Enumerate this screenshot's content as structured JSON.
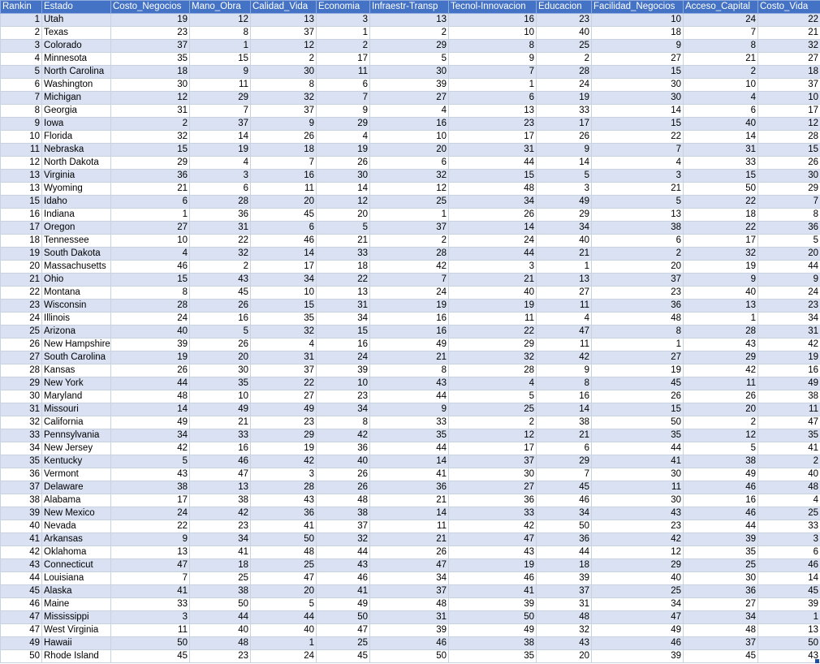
{
  "columns": [
    "Rankin",
    "Estado",
    "Costo_Negocios",
    "Mano_Obra",
    "Calidad_Vida",
    "Economia",
    "Infraestr-Transp",
    "Tecnol-Innovacion",
    "Educacion",
    "Facilidad_Negocios",
    "Acceso_Capital",
    "Costo_Vida"
  ],
  "rows": [
    [
      "1",
      "Utah",
      "19",
      "12",
      "13",
      "3",
      "13",
      "16",
      "23",
      "10",
      "24",
      "22"
    ],
    [
      "2",
      "Texas",
      "23",
      "8",
      "37",
      "1",
      "2",
      "10",
      "40",
      "18",
      "7",
      "21"
    ],
    [
      "3",
      "Colorado",
      "37",
      "1",
      "12",
      "2",
      "29",
      "8",
      "25",
      "9",
      "8",
      "32"
    ],
    [
      "4",
      "Minnesota",
      "35",
      "15",
      "2",
      "17",
      "5",
      "9",
      "2",
      "27",
      "21",
      "27"
    ],
    [
      "5",
      "North Carolina",
      "18",
      "9",
      "30",
      "11",
      "30",
      "7",
      "28",
      "15",
      "2",
      "18"
    ],
    [
      "6",
      "Washington",
      "30",
      "11",
      "8",
      "6",
      "39",
      "1",
      "24",
      "30",
      "10",
      "37"
    ],
    [
      "7",
      "Michigan",
      "12",
      "29",
      "32",
      "7",
      "27",
      "6",
      "19",
      "30",
      "4",
      "10"
    ],
    [
      "8",
      "Georgia",
      "31",
      "7",
      "37",
      "9",
      "4",
      "13",
      "33",
      "14",
      "6",
      "17"
    ],
    [
      "9",
      "Iowa",
      "2",
      "37",
      "9",
      "29",
      "16",
      "23",
      "17",
      "15",
      "40",
      "12"
    ],
    [
      "10",
      "Florida",
      "32",
      "14",
      "26",
      "4",
      "10",
      "17",
      "26",
      "22",
      "14",
      "28"
    ],
    [
      "11",
      "Nebraska",
      "15",
      "19",
      "18",
      "19",
      "20",
      "31",
      "9",
      "7",
      "31",
      "15"
    ],
    [
      "12",
      "North Dakota",
      "29",
      "4",
      "7",
      "26",
      "6",
      "44",
      "14",
      "4",
      "33",
      "26"
    ],
    [
      "13",
      "Virginia",
      "36",
      "3",
      "16",
      "30",
      "32",
      "15",
      "5",
      "3",
      "15",
      "30"
    ],
    [
      "13",
      "Wyoming",
      "21",
      "6",
      "11",
      "14",
      "12",
      "48",
      "3",
      "21",
      "50",
      "29"
    ],
    [
      "15",
      "Idaho",
      "6",
      "28",
      "20",
      "12",
      "25",
      "34",
      "49",
      "5",
      "22",
      "7"
    ],
    [
      "16",
      "Indiana",
      "1",
      "36",
      "45",
      "20",
      "1",
      "26",
      "29",
      "13",
      "18",
      "8"
    ],
    [
      "17",
      "Oregon",
      "27",
      "31",
      "6",
      "5",
      "37",
      "14",
      "34",
      "38",
      "22",
      "36"
    ],
    [
      "18",
      "Tennessee",
      "10",
      "22",
      "46",
      "21",
      "2",
      "24",
      "40",
      "6",
      "17",
      "5"
    ],
    [
      "19",
      "South Dakota",
      "4",
      "32",
      "14",
      "33",
      "28",
      "44",
      "21",
      "2",
      "32",
      "20"
    ],
    [
      "20",
      "Massachusetts",
      "46",
      "2",
      "17",
      "18",
      "42",
      "3",
      "1",
      "20",
      "19",
      "44"
    ],
    [
      "21",
      "Ohio",
      "15",
      "43",
      "34",
      "22",
      "7",
      "21",
      "13",
      "37",
      "9",
      "9"
    ],
    [
      "22",
      "Montana",
      "8",
      "45",
      "10",
      "13",
      "24",
      "40",
      "27",
      "23",
      "40",
      "24"
    ],
    [
      "23",
      "Wisconsin",
      "28",
      "26",
      "15",
      "31",
      "19",
      "19",
      "11",
      "36",
      "13",
      "23"
    ],
    [
      "24",
      "Illinois",
      "24",
      "16",
      "35",
      "34",
      "16",
      "11",
      "4",
      "48",
      "1",
      "34"
    ],
    [
      "25",
      "Arizona",
      "40",
      "5",
      "32",
      "15",
      "16",
      "22",
      "47",
      "8",
      "28",
      "31"
    ],
    [
      "26",
      "New Hampshire",
      "39",
      "26",
      "4",
      "16",
      "49",
      "29",
      "11",
      "1",
      "43",
      "42"
    ],
    [
      "27",
      "South Carolina",
      "19",
      "20",
      "31",
      "24",
      "21",
      "32",
      "42",
      "27",
      "29",
      "19"
    ],
    [
      "28",
      "Kansas",
      "26",
      "30",
      "37",
      "39",
      "8",
      "28",
      "9",
      "19",
      "42",
      "16"
    ],
    [
      "29",
      "New York",
      "44",
      "35",
      "22",
      "10",
      "43",
      "4",
      "8",
      "45",
      "11",
      "49"
    ],
    [
      "30",
      "Maryland",
      "48",
      "10",
      "27",
      "23",
      "44",
      "5",
      "16",
      "26",
      "26",
      "38"
    ],
    [
      "31",
      "Missouri",
      "14",
      "49",
      "49",
      "34",
      "9",
      "25",
      "14",
      "15",
      "20",
      "11"
    ],
    [
      "32",
      "California",
      "49",
      "21",
      "23",
      "8",
      "33",
      "2",
      "38",
      "50",
      "2",
      "47"
    ],
    [
      "33",
      "Pennsylvania",
      "34",
      "33",
      "29",
      "42",
      "35",
      "12",
      "21",
      "35",
      "12",
      "35"
    ],
    [
      "34",
      "New Jersey",
      "42",
      "16",
      "19",
      "36",
      "44",
      "17",
      "6",
      "44",
      "5",
      "41"
    ],
    [
      "35",
      "Kentucky",
      "5",
      "46",
      "42",
      "40",
      "14",
      "37",
      "29",
      "41",
      "38",
      "2"
    ],
    [
      "36",
      "Vermont",
      "43",
      "47",
      "3",
      "26",
      "41",
      "30",
      "7",
      "30",
      "49",
      "40"
    ],
    [
      "37",
      "Delaware",
      "38",
      "13",
      "28",
      "26",
      "36",
      "27",
      "45",
      "11",
      "46",
      "48"
    ],
    [
      "38",
      "Alabama",
      "17",
      "38",
      "43",
      "48",
      "21",
      "36",
      "46",
      "30",
      "16",
      "4"
    ],
    [
      "39",
      "New Mexico",
      "24",
      "42",
      "36",
      "38",
      "14",
      "33",
      "34",
      "43",
      "46",
      "25"
    ],
    [
      "40",
      "Nevada",
      "22",
      "23",
      "41",
      "37",
      "11",
      "42",
      "50",
      "23",
      "44",
      "33"
    ],
    [
      "41",
      "Arkansas",
      "9",
      "34",
      "50",
      "32",
      "21",
      "47",
      "36",
      "42",
      "39",
      "3"
    ],
    [
      "42",
      "Oklahoma",
      "13",
      "41",
      "48",
      "44",
      "26",
      "43",
      "44",
      "12",
      "35",
      "6"
    ],
    [
      "43",
      "Connecticut",
      "47",
      "18",
      "25",
      "43",
      "47",
      "19",
      "18",
      "29",
      "25",
      "46"
    ],
    [
      "44",
      "Louisiana",
      "7",
      "25",
      "47",
      "46",
      "34",
      "46",
      "39",
      "40",
      "30",
      "14"
    ],
    [
      "45",
      "Alaska",
      "41",
      "38",
      "20",
      "41",
      "37",
      "41",
      "37",
      "25",
      "36",
      "45"
    ],
    [
      "46",
      "Maine",
      "33",
      "50",
      "5",
      "49",
      "48",
      "39",
      "31",
      "34",
      "27",
      "39"
    ],
    [
      "47",
      "Mississippi",
      "3",
      "44",
      "44",
      "50",
      "31",
      "50",
      "48",
      "47",
      "34",
      "1"
    ],
    [
      "47",
      "West Virginia",
      "11",
      "40",
      "40",
      "47",
      "39",
      "49",
      "32",
      "49",
      "48",
      "13"
    ],
    [
      "49",
      "Hawaii",
      "50",
      "48",
      "1",
      "25",
      "46",
      "38",
      "43",
      "46",
      "37",
      "50"
    ],
    [
      "50",
      "Rhode Island",
      "45",
      "23",
      "24",
      "45",
      "50",
      "35",
      "20",
      "39",
      "45",
      "43"
    ]
  ],
  "colors": {
    "header_bg": "#4472c4",
    "header_text": "#ffffff",
    "band_row": "#d9e1f2",
    "plain_row": "#ffffff"
  },
  "icons": [
    "fill-handle"
  ]
}
